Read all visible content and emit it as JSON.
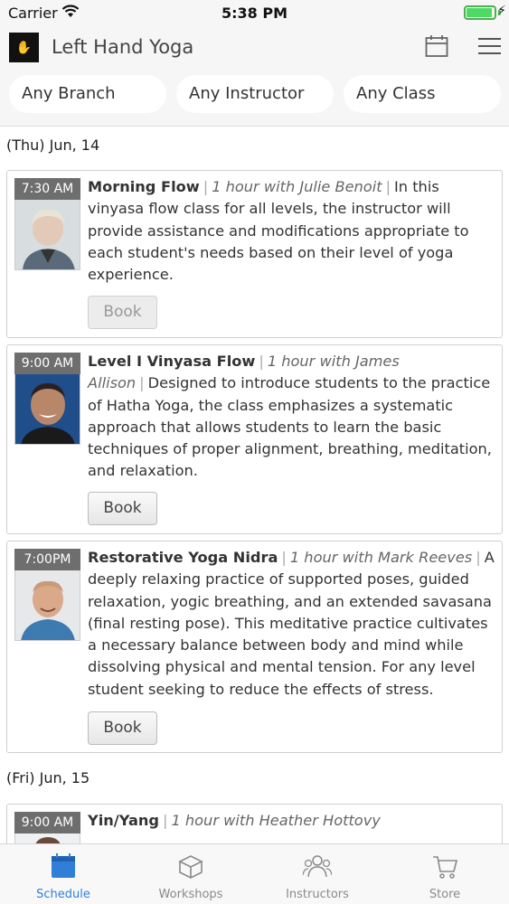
{
  "status_bar": {
    "carrier": "Carrier",
    "time": "5:38 PM",
    "battery_level": 0.92,
    "icons": [
      "wifi-icon",
      "battery-icon",
      "charging-bolt-icon"
    ]
  },
  "header": {
    "logo_text": "Yoga",
    "title": "Left Hand Yoga",
    "icons": [
      "calendar-icon",
      "hamburger-menu-icon"
    ]
  },
  "filters": {
    "branch": "Any Branch",
    "instructor": "Any Instructor",
    "class": "Any Class"
  },
  "days": [
    {
      "label": "(Thu) Jun, 14",
      "classes": [
        {
          "time": "7:30 AM",
          "name": "Morning Flow",
          "meta": "1 hour with Julie Benoit",
          "description": "In this vinyasa flow class for all levels, the instructor will provide assistance and modifications appropriate to each student's needs based on their level of yoga experience.",
          "book_label": "Book",
          "book_enabled": false
        },
        {
          "time": "9:00 AM",
          "name": "Level I Vinyasa Flow",
          "meta": "1 hour with James Allison",
          "description": "Designed to introduce students to the practice of Hatha Yoga, the class emphasizes a systematic approach that allows students to learn the basic techniques of proper alignment, breathing, meditation, and relaxation.",
          "book_label": "Book",
          "book_enabled": true
        },
        {
          "time": "7:00PM",
          "name": "Restorative Yoga Nidra",
          "meta": "1 hour with Mark Reeves",
          "description": "A deeply relaxing practice of supported poses, guided relaxation, yogic breathing, and an extended savasana (final resting pose). This meditative practice cultivates a necessary balance between body and mind while dissolving physical and mental tension. For any level student seeking to reduce the effects of stress.",
          "book_label": "Book",
          "book_enabled": true
        }
      ]
    },
    {
      "label": "(Fri) Jun, 15",
      "classes": [
        {
          "time": "9:00 AM",
          "name": "Yin/Yang",
          "meta": "1 hour with Heather Hottovy",
          "description": ""
        }
      ]
    }
  ],
  "tabs": [
    {
      "label": "Schedule",
      "icon": "calendar-icon",
      "active": true
    },
    {
      "label": "Workshops",
      "icon": "box-icon",
      "active": false
    },
    {
      "label": "Instructors",
      "icon": "people-icon",
      "active": false
    },
    {
      "label": "Store",
      "icon": "cart-icon",
      "active": false
    }
  ],
  "colors": {
    "accent": "#2f7fd8",
    "time_label_bg": "#6e6e6e",
    "battery": "#4cd964"
  }
}
